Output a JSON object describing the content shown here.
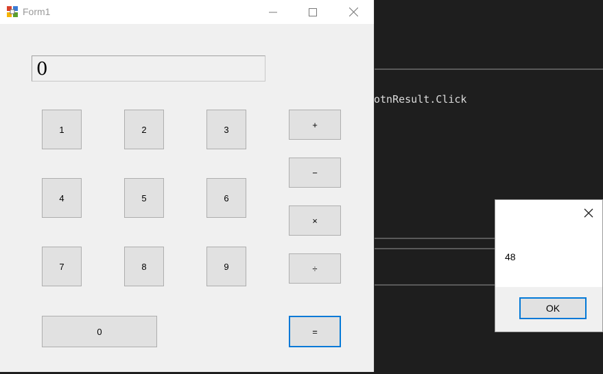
{
  "window": {
    "title": "Form1"
  },
  "display": {
    "value": "0"
  },
  "keys": {
    "k1": "1",
    "k2": "2",
    "k3": "3",
    "k4": "4",
    "k5": "5",
    "k6": "6",
    "k7": "7",
    "k8": "8",
    "k9": "9",
    "k0": "0",
    "plus": "+",
    "minus": "−",
    "times": "×",
    "divide": "÷",
    "equals": "="
  },
  "ide": {
    "code": "otnResult.Click"
  },
  "dialog": {
    "message": "48",
    "ok_label": "OK"
  },
  "colors": {
    "focus_accent": "#0078d7",
    "form_bg": "#f0f0f0",
    "ide_bg": "#1e1e1e"
  },
  "icons": [
    "app-icon",
    "minimize-icon",
    "maximize-icon",
    "close-icon"
  ]
}
